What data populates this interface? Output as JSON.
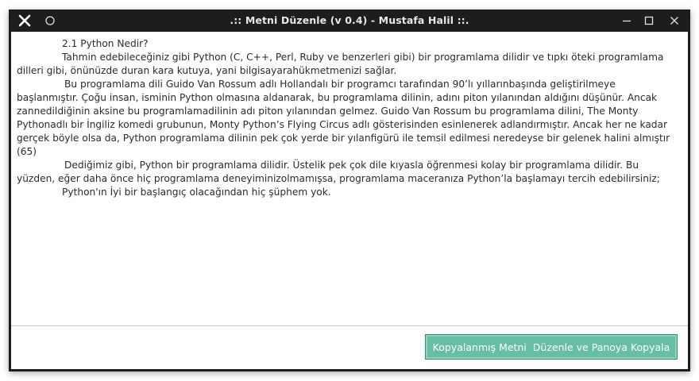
{
  "window": {
    "title": ".:: Metni Düzenle (v 0.4) - Mustafa Halil ::.",
    "titlebar_color": "#1c1d1f",
    "close_icon": "close-x-icon",
    "pin_icon": "circle-icon",
    "minimize_icon": "minimize-icon",
    "maximize_icon": "maximize-icon"
  },
  "editor": {
    "paragraphs": [
      "2.1 Python Nedir?",
      "Tahmin edebileceğiniz gibi Python (C, C++, Perl, Ruby ve benzerleri gibi) bir programlama dilidir ve tıpkı öteki programlama dilleri gibi, önünüzde duran kara kutuya, yani bilgisayarahükmetmenizi sağlar.",
      " Bu programlama dili Guido Van Rossum adlı Hollandalı bir programcı tarafından 90’lı yıllarınbaşında geliştirilmeye başlanmıştır. Çoğu insan, isminin Python olmasına aldanarak, bu programlama dilinin, adını piton yılanından aldığını düşünür. Ancak zannedildiğinin aksine bu programlamadilinin adı piton yılanından gelmez. Guido Van Rossum bu programlama dilini, The Monty Pythonadlı bir İngiliz komedi grubunun, Monty Python’s Flying Circus adlı gösterisinden esinlenerek adlandırmıştır. Ancak her ne kadar gerçek böyle olsa da, Python programlama dilinin pek çok yerde bir yılanfigürü ile temsil edilmesi neredeyse bir gelenek halini almıştır (65)",
      " Dediğimiz gibi, Python bir programlama dilidir. Üstelik pek çok dile kıyasla öğrenmesi kolay bir programlama dilidir. Bu yüzden, eğer daha önce hiç programlama deneyiminizolmamışsa, programlama maceranıza Python’la başlamayı tercih edebilirsiniz;",
      "Python'ın İyi bir başlangıç olacağından hiç şüphem yok."
    ]
  },
  "actions": {
    "copy_button_label": "Kopyalanmış Metni  Düzenle ve Panoya Kopyala",
    "copy_button_color": "#66bfa4"
  }
}
